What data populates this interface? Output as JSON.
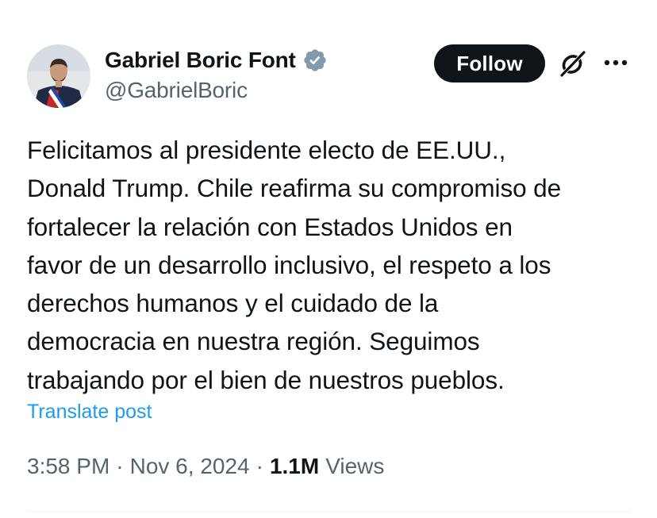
{
  "author": {
    "display_name": "Gabriel Boric Font",
    "handle": "@GabrielBoric",
    "verified_icon": "verified-badge-icon"
  },
  "actions": {
    "follow_label": "Follow",
    "grok_icon": "grok-icon",
    "more_icon": "more-icon"
  },
  "tweet": {
    "text": "Felicitamos al presidente electo de EE.UU.,\nDonald Trump. Chile reafirma su compromiso de\nfortalecer la relación con Estados Unidos en\nfavor de un desarrollo inclusivo, el respeto a los\nderechos humanos y el cuidado de la\ndemocracia en nuestra región. Seguimos\ntrabajando por el bien de nuestros pueblos.",
    "translate_label": "Translate post"
  },
  "meta": {
    "time": "3:58 PM",
    "separator": "·",
    "date": "Nov 6, 2024",
    "views_count": "1.1M",
    "views_label": "Views"
  },
  "colors": {
    "text": "#0f1419",
    "secondary": "#536471",
    "link": "#1d9bf0",
    "follow_bg": "#0f1419",
    "verified": "#829aab"
  }
}
